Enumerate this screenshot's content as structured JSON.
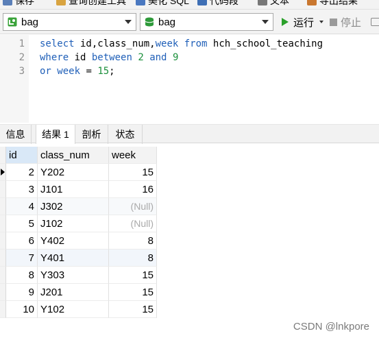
{
  "toolbar": {
    "items": [
      {
        "label": "保存",
        "icon": "save-icon"
      },
      {
        "label": "查询创建工具",
        "icon": "query-builder-icon"
      },
      {
        "label": "美化 SQL",
        "icon": "beautify-sql-icon"
      },
      {
        "label": "代码段",
        "icon": "code-snippet-icon"
      },
      {
        "label": "文本",
        "icon": "text-icon"
      },
      {
        "label": "导出结果",
        "icon": "export-icon"
      }
    ]
  },
  "connection": {
    "connection_value": "bag",
    "database_value": "bag",
    "run_label": "运行",
    "stop_label": "停止"
  },
  "editor": {
    "lines": [
      "1",
      "2",
      "3"
    ],
    "line1": {
      "kw1": "select",
      "t1": " id,class_num,",
      "kw2": "week",
      "t2": " ",
      "kw3": "from",
      "t3": " hch_school_teaching"
    },
    "line2": {
      "kw1": "where",
      "t1": " id ",
      "kw2": "between",
      "t2": " ",
      "n1": "2",
      "t3": " ",
      "kw3": "and",
      "t4": " ",
      "n2": "9"
    },
    "line3": {
      "kw1": "or",
      "t1": " ",
      "kw2": "week",
      "t2": " = ",
      "n1": "15",
      "t3": ";"
    }
  },
  "tabs": [
    "信息",
    "结果 1",
    "剖析",
    "状态"
  ],
  "result": {
    "columns": [
      "id",
      "class_num",
      "week"
    ],
    "rows": [
      {
        "id": "2",
        "class_num": "Y202",
        "week": "15"
      },
      {
        "id": "3",
        "class_num": "J101",
        "week": "16"
      },
      {
        "id": "4",
        "class_num": "J302",
        "week": "(Null)"
      },
      {
        "id": "5",
        "class_num": "J102",
        "week": "(Null)"
      },
      {
        "id": "6",
        "class_num": "Y402",
        "week": "8"
      },
      {
        "id": "7",
        "class_num": "Y401",
        "week": "8"
      },
      {
        "id": "8",
        "class_num": "Y303",
        "week": "15"
      },
      {
        "id": "9",
        "class_num": "J201",
        "week": "15"
      },
      {
        "id": "10",
        "class_num": "Y102",
        "week": "15"
      }
    ]
  },
  "watermark": "CSDN @lnkpore",
  "colors": {
    "keyword": "#1f5fb8",
    "number": "#1a8f3a",
    "run": "#2aa02a",
    "database": "#2e9a3a",
    "connection": "#3aa33a"
  }
}
